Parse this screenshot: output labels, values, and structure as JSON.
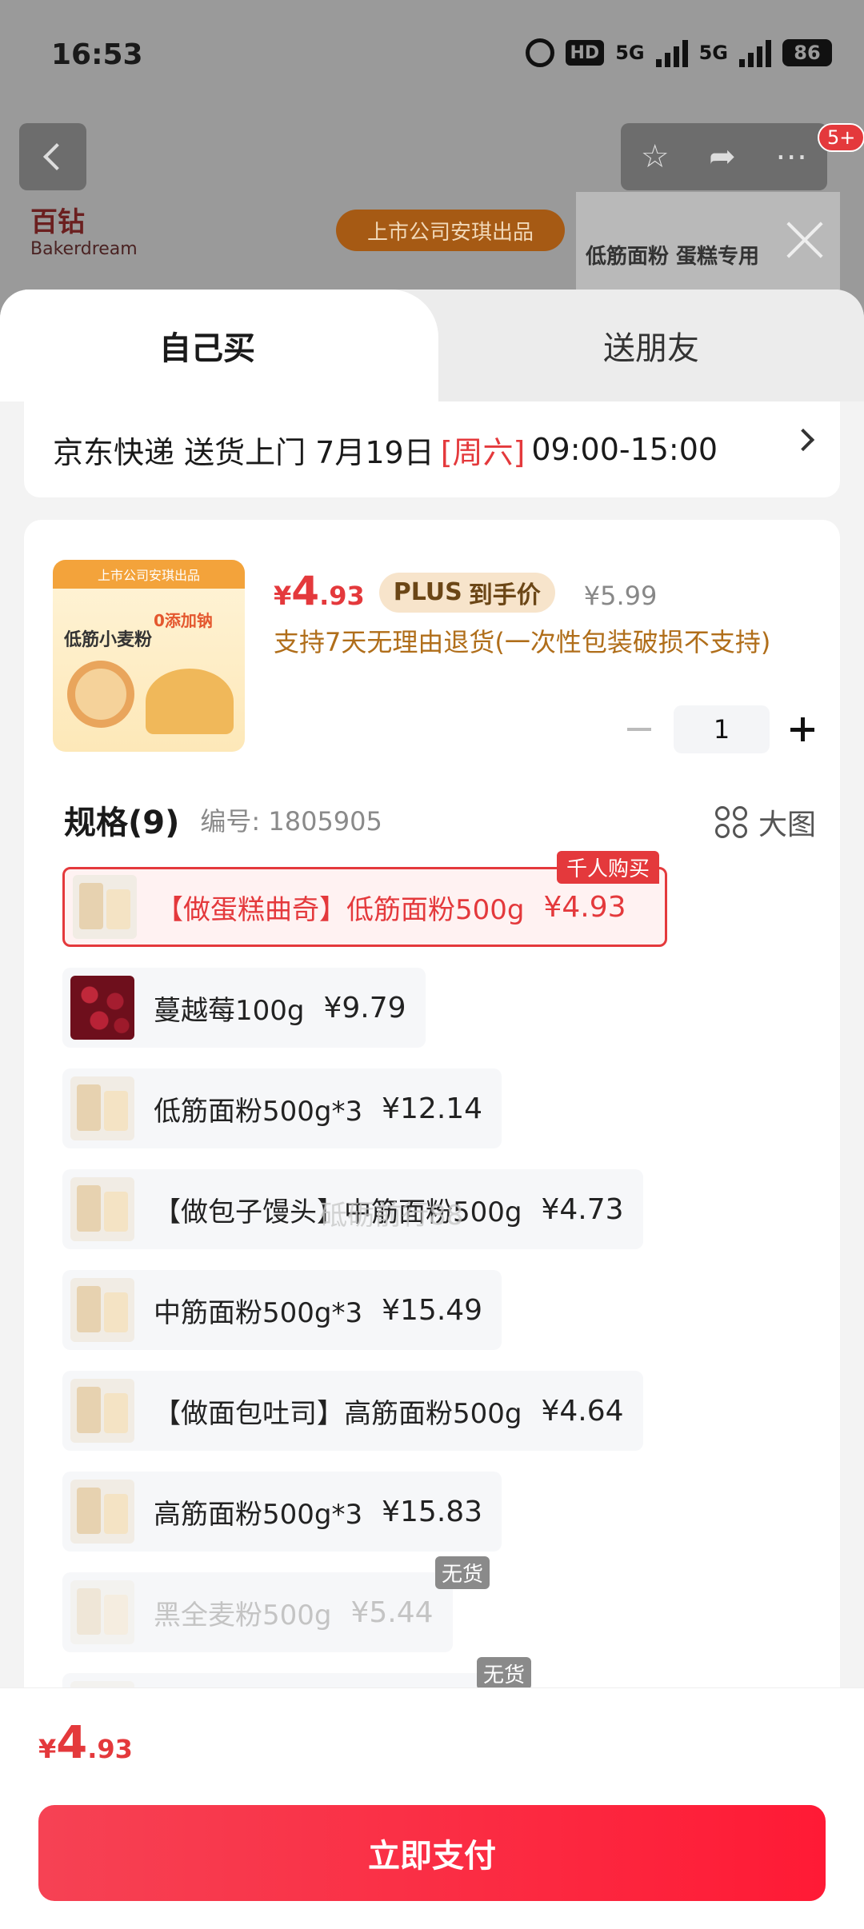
{
  "status_bar": {
    "time": "16:53",
    "hd": "HD",
    "network_a": "5G",
    "network_b": "5G",
    "battery": "86"
  },
  "background_page": {
    "cart_badge": "5+",
    "brand_cn": "百钻",
    "brand_en": "Bakerdream",
    "listed_tag": "上市公司安琪出品",
    "pack_text": "低筋面粉 蛋糕专用",
    "icons": [
      "back-icon",
      "star-icon",
      "share-icon",
      "more-icon",
      "close-icon"
    ]
  },
  "tabs": {
    "self": "自己买",
    "gift": "送朋友"
  },
  "delivery": {
    "text": "京东快递 送货上门 7月19日",
    "weekday": "[周六]",
    "time_range": "09:00-15:00"
  },
  "product": {
    "thumb_band": "上市公司安琪出品",
    "thumb_title": "低筋小麦粉",
    "thumb_tag": "0添加钠",
    "price_yen": "¥",
    "price_int": "4",
    "price_dec": ".93",
    "plus_label": "PLUS",
    "plus_text": "到手价",
    "original_price": "¥5.99",
    "return_note": "支持7天无理由退货(一次性包装破损不支持)",
    "quantity": "1"
  },
  "spec": {
    "title": "规格(9)",
    "code": "编号: 1805905",
    "big_image": "大图",
    "options": [
      {
        "name": "【做蛋糕曲奇】低筋面粉500g",
        "price": "¥4.93",
        "badge": "千人购买",
        "state": "selected"
      },
      {
        "name": "蔓越莓100g",
        "price": "¥9.79",
        "state": "normal"
      },
      {
        "name": "低筋面粉500g*3",
        "price": "¥12.14",
        "state": "normal"
      },
      {
        "name": "【做包子馒头】中筋面粉500g",
        "price": "¥4.73",
        "state": "normal"
      },
      {
        "name": "中筋面粉500g*3",
        "price": "¥15.49",
        "state": "normal"
      },
      {
        "name": "【做面包吐司】高筋面粉500g",
        "price": "¥4.64",
        "state": "normal"
      },
      {
        "name": "高筋面粉500g*3",
        "price": "¥15.83",
        "state": "normal"
      },
      {
        "name": "黑全麦粉500g",
        "price": "¥5.44",
        "badge": "无货",
        "state": "disabled"
      },
      {
        "name": "",
        "price": "",
        "badge": "无货",
        "state": "disabled"
      }
    ]
  },
  "watermark": "砥砺前行88",
  "footer": {
    "total_yen": "¥",
    "total_int": "4",
    "total_dec": ".93",
    "pay_label": "立即支付"
  },
  "colors": {
    "accent_red": "#e4393c",
    "plus_gold": "#f7e4cb",
    "return_note_brown": "#b06e1a"
  }
}
